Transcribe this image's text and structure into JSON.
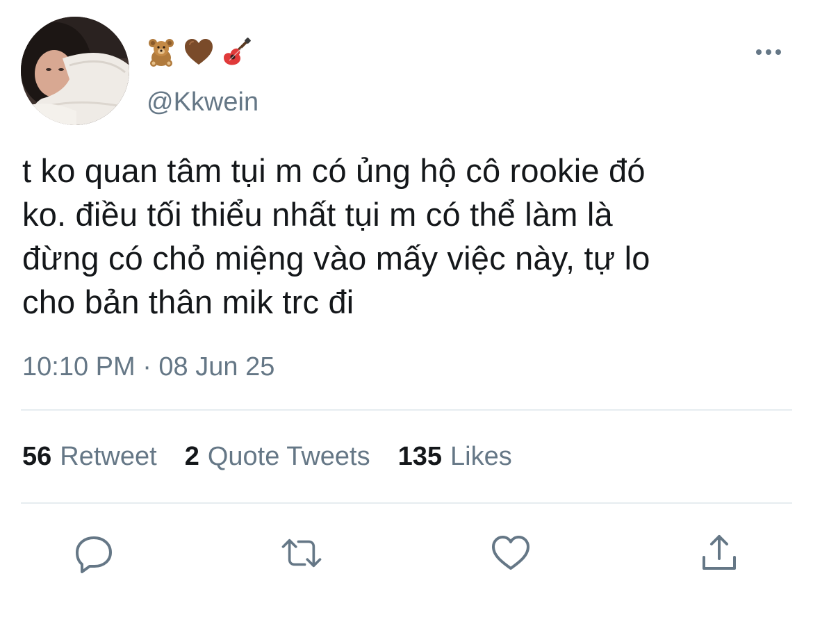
{
  "tweet": {
    "display_name_emojis": [
      "teddy-bear",
      "brown-heart",
      "guitar"
    ],
    "handle": "@Kkwein",
    "text_lines": [
      "t ko quan tâm tụi m có ủng hộ cô rookie đó",
      "ko. điều tối thiểu nhất tụi m có thể làm là",
      "đừng có chỏ miệng vào mấy việc này, tự lo",
      "cho bản thân mik trc đi"
    ],
    "timestamp": "10:10 PM · 08 Jun 25"
  },
  "stats": {
    "retweets": {
      "count": "56",
      "label": "Retweet"
    },
    "quotes": {
      "count": "2",
      "label": "Quote Tweets"
    },
    "likes": {
      "count": "135",
      "label": "Likes"
    }
  },
  "actions": {
    "icons": [
      "reply-icon",
      "retweet-icon",
      "like-icon",
      "share-icon"
    ]
  },
  "colors": {
    "text": "#14171a",
    "secondary": "#657786",
    "divider": "#e6ecf0",
    "icon": "#657786"
  }
}
